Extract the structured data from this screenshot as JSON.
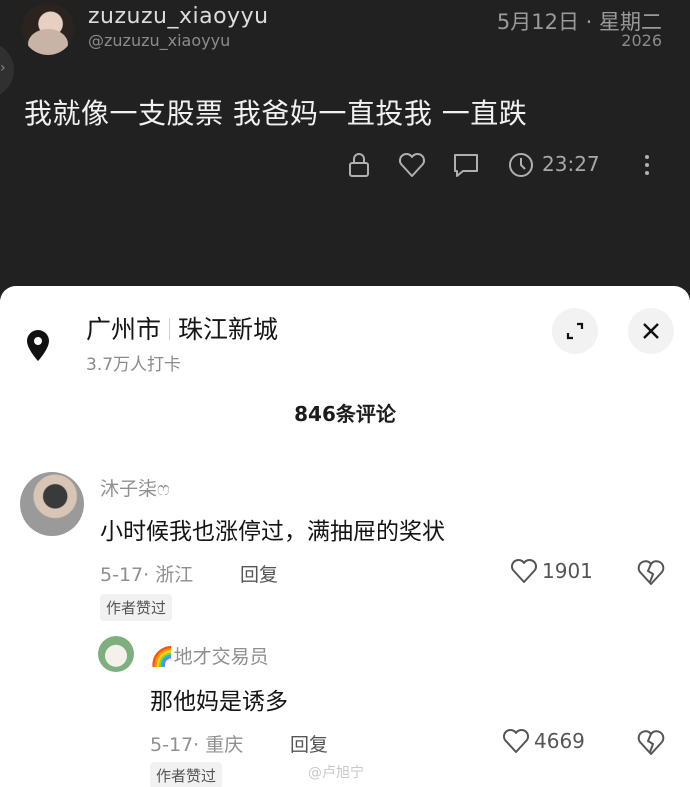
{
  "post": {
    "username": "zuzuzu_xiaoyyu",
    "handle": "@zuzuzu_xiaoyyu",
    "date": "5月12日 · 星期二",
    "year": "2026",
    "text": "我就像一支股票 我爸妈一直投我 一直跌",
    "time": "23:27",
    "icons": [
      "lock-icon",
      "heart-icon",
      "comment-icon",
      "clock-icon",
      "more-icon"
    ]
  },
  "location": {
    "city": "广州市",
    "district": "珠江新城",
    "checkins": "3.7万人打卡"
  },
  "comments_header": "846条评论",
  "comments": [
    {
      "name": "沐子柒ෆ",
      "text": "小时候我也涨停过，满抽屉的奖状",
      "meta": "5-17· 浙江",
      "reply_label": "回复",
      "likes": "1901",
      "badge": "作者赞过"
    },
    {
      "name": "🌈地才交易员",
      "text": "那他妈是诱多",
      "meta": "5-17· 重庆",
      "reply_label": "回复",
      "likes": "4669",
      "badge": "作者赞过"
    }
  ],
  "watermark": "@卢旭宁",
  "colors": {
    "post_bg": "#212121",
    "sheet_bg": "#ffffff"
  }
}
